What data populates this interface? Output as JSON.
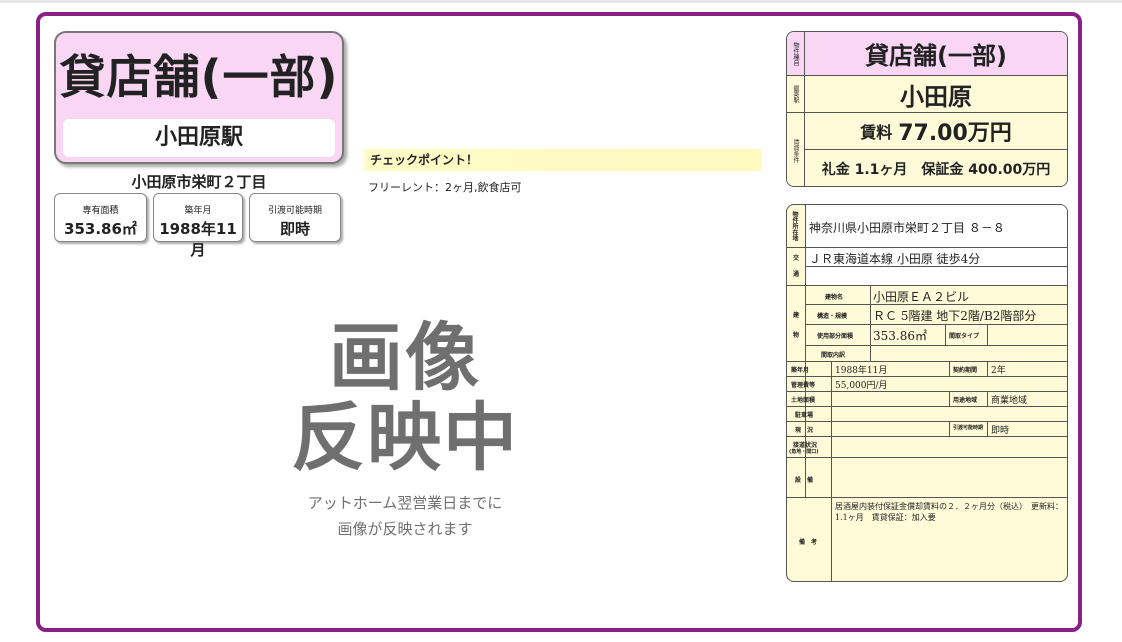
{
  "listing": {
    "type": "貸店舗(一部)",
    "station": "小田原駅",
    "address_short": "小田原市栄町２丁目",
    "stats": [
      {
        "label": "専有面積",
        "value": "353.86㎡"
      },
      {
        "label": "築年月",
        "value": "1988年11月"
      },
      {
        "label": "引渡可能時期",
        "value": "即時"
      }
    ]
  },
  "checkpoint": {
    "title": "チェックポイント！",
    "text": "フリーレント：2ヶ月,飲食店可"
  },
  "placeholder": {
    "big1": "画像",
    "big2": "反映中",
    "line1": "アットホーム翌営業日までに",
    "line2": "画像が反映されます"
  },
  "summary": {
    "type_label": "物件種目",
    "type": "貸店舗(一部)",
    "station_label": "最寄駅",
    "station": "小田原",
    "terms_label": "賃貸条件",
    "rent_prefix": "賃料",
    "rent_value": "77.00万円",
    "deposit": "礼金 1.1ヶ月　保証金 400.00万円"
  },
  "details": {
    "location_label": "物件所在地",
    "location": "神奈川県小田原市栄町２丁目 ８－８",
    "transport_label1": "交",
    "transport_label2": "通",
    "transport": "ＪＲ東海道本線 小田原 徒歩4分",
    "building_label1": "建",
    "building_label2": "物",
    "building_name_label": "建物名",
    "building_name": "小田原ＥＡ２ビル",
    "structure_label": "構造・規模",
    "structure": "ＲＣ 5階建 地下2階/B2階部分",
    "area_label": "使用部分面積",
    "area": "353.86㎡",
    "layout_type_label": "間取タイプ",
    "layout_detail_label": "間取内訳",
    "built_label": "築年月",
    "built": "1988年11月",
    "contract_label": "契約期間",
    "contract": "2年",
    "mgmt_label": "管理費等",
    "mgmt": "55,000円/月",
    "land_label": "土地面積",
    "zoning_label": "用途地域",
    "zoning": "商業地域",
    "parking_label": "駐車場",
    "status_label": "現　況",
    "handover_label": "引渡可能時期",
    "handover": "即時",
    "road_label": "接道状況",
    "road_sub": "(角地・間口)",
    "facility_label": "設　備",
    "remarks_label": "備　考",
    "remarks": "居酒屋内装付保証金償却賃料の２．２ヶ月分（税込）　更新料：1.1ヶ月　賃貸保証：加入要"
  },
  "colors": {
    "frame": "#8a1f86",
    "pink": "#f8d6f4",
    "cream": "#fffbd9",
    "yellow": "#fffac0"
  }
}
